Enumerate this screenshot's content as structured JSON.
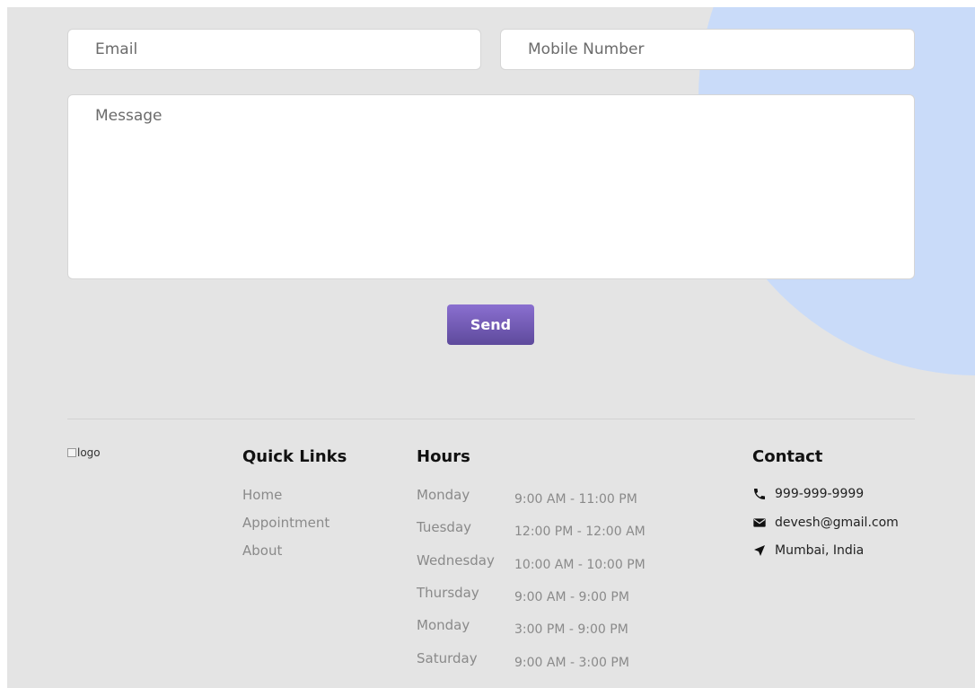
{
  "form": {
    "email_placeholder": "Email",
    "mobile_placeholder": "Mobile Number",
    "message_placeholder": "Message",
    "send_label": "Send"
  },
  "footer": {
    "logo_alt": "logo",
    "quick_links": {
      "title": "Quick Links",
      "items": [
        "Home",
        "Appointment",
        "About"
      ]
    },
    "hours": {
      "title": "Hours",
      "rows": [
        {
          "day": "Monday",
          "time": "9:00 AM - 11:00 PM"
        },
        {
          "day": "Tuesday",
          "time": "12:00 PM - 12:00 AM"
        },
        {
          "day": "Wednesday",
          "time": "10:00 AM - 10:00 PM"
        },
        {
          "day": "Thursday",
          "time": "9:00 AM - 9:00 PM"
        },
        {
          "day": "Monday",
          "time": "3:00 PM - 9:00 PM"
        },
        {
          "day": "Saturday",
          "time": "9:00 AM - 3:00 PM"
        }
      ]
    },
    "contact": {
      "title": "Contact",
      "phone": "999-999-9999",
      "email": "devesh@gmail.com",
      "location": "Mumbai, India",
      "icons": [
        "phone-icon",
        "envelope-icon",
        "location-arrow-icon"
      ]
    }
  },
  "colors": {
    "page_bg": "#e4e4e4",
    "accent_blob": "#c9dbf9",
    "button_top": "#8a6fd0",
    "button_bottom": "#5e4a9c"
  }
}
